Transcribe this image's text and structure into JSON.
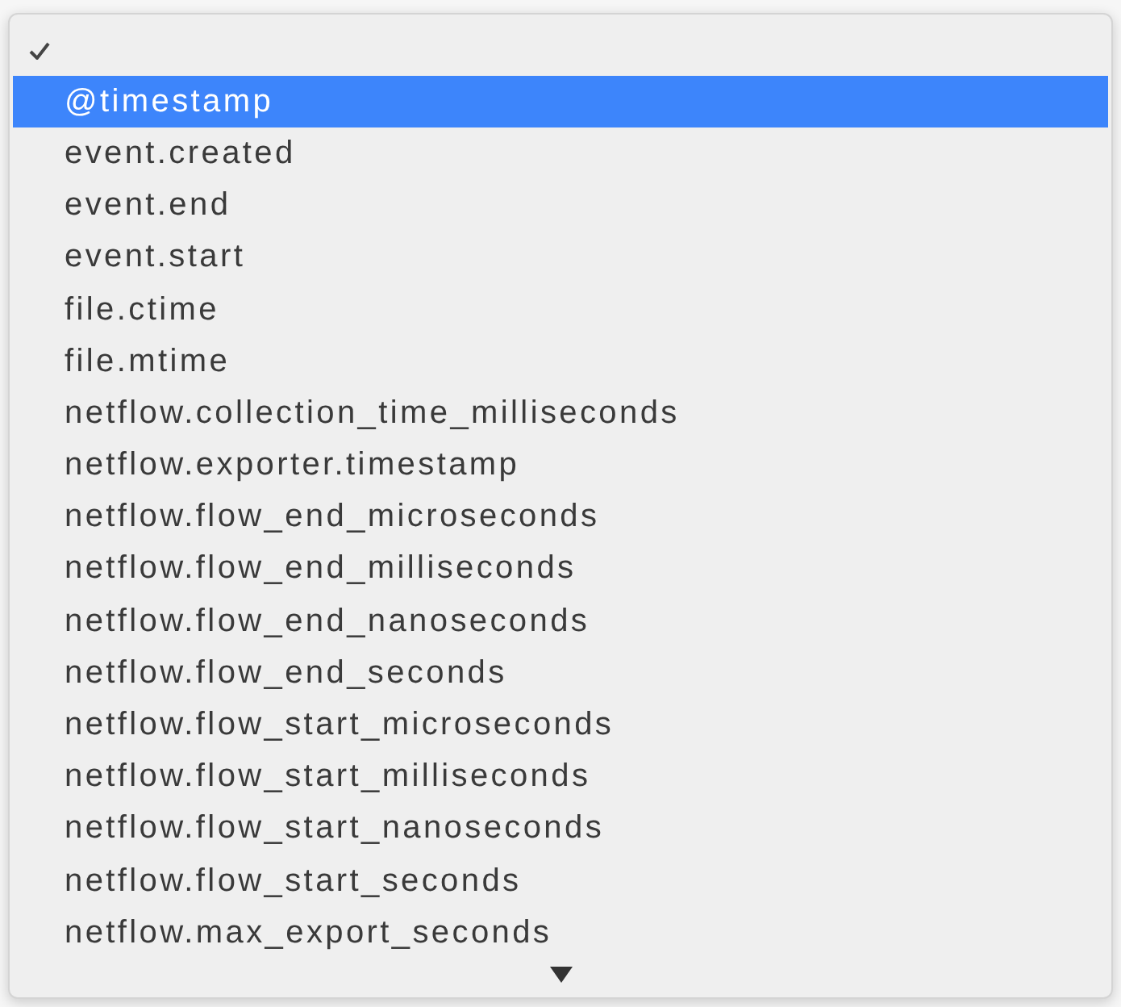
{
  "menu": {
    "items": [
      {
        "checked": true,
        "selected": false
      },
      {
        "label": "@timestamp",
        "checked": false,
        "selected": true
      },
      {
        "label": "event.created",
        "checked": false,
        "selected": false
      },
      {
        "label": "event.end",
        "checked": false,
        "selected": false
      },
      {
        "label": "event.start",
        "checked": false,
        "selected": false
      },
      {
        "label": "file.ctime",
        "checked": false,
        "selected": false
      },
      {
        "label": "file.mtime",
        "checked": false,
        "selected": false
      },
      {
        "label": "netflow.collection_time_milliseconds",
        "checked": false,
        "selected": false
      },
      {
        "label": "netflow.exporter.timestamp",
        "checked": false,
        "selected": false
      },
      {
        "label": "netflow.flow_end_microseconds",
        "checked": false,
        "selected": false
      },
      {
        "label": "netflow.flow_end_milliseconds",
        "checked": false,
        "selected": false
      },
      {
        "label": "netflow.flow_end_nanoseconds",
        "checked": false,
        "selected": false
      },
      {
        "label": "netflow.flow_end_seconds",
        "checked": false,
        "selected": false
      },
      {
        "label": "netflow.flow_start_microseconds",
        "checked": false,
        "selected": false
      },
      {
        "label": "netflow.flow_start_milliseconds",
        "checked": false,
        "selected": false
      },
      {
        "label": "netflow.flow_start_nanoseconds",
        "checked": false,
        "selected": false
      },
      {
        "label": "netflow.flow_start_seconds",
        "checked": false,
        "selected": false
      },
      {
        "label": "netflow.max_export_seconds",
        "checked": false,
        "selected": false
      }
    ],
    "more_below": true
  }
}
